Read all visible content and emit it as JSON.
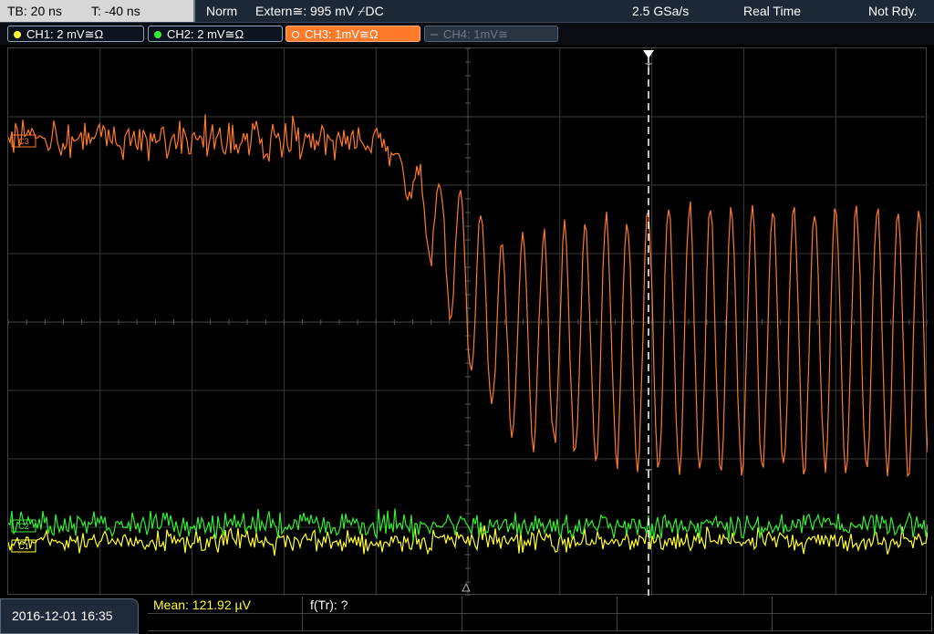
{
  "topbar": {
    "tb_label": "TB: 20 ns",
    "t_label": "T: -40 ns",
    "mode": "Norm",
    "trigger": "Extern≅: 995 mV ⌿DC",
    "sample_rate": "2.5 GSa/s",
    "acq_mode": "Real Time",
    "status": "Not Rdy."
  },
  "channels": [
    {
      "label": "CH1: 2 mV≅Ω",
      "color": "#ffff33",
      "state": "on"
    },
    {
      "label": "CH2: 2 mV≅Ω",
      "color": "#33ee33",
      "state": "on"
    },
    {
      "label": "CH3: 1mV≅Ω",
      "color": "#ff7a2a",
      "state": "active"
    },
    {
      "label": "CH4: 1mV≅",
      "color": "#6e7886",
      "state": "off"
    }
  ],
  "markers": {
    "ch3": "C3",
    "ch2": "C2",
    "ch1": "C1",
    "trigger_top": "T",
    "trigger_mid": "T"
  },
  "colors": {
    "ch1": "#ffff33",
    "ch2": "#33ee33",
    "ch3": "#ff7a2a",
    "grid": "#3a3a3a",
    "cursor": "#ffffff"
  },
  "footer": {
    "datetime": "2016-12-01 16:35",
    "mean": "Mean: 121.92 µV",
    "ftr": "f(Tr): ?"
  }
}
